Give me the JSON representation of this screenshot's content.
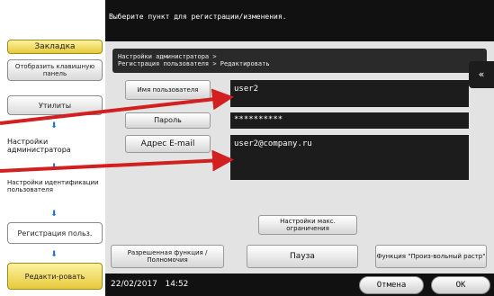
{
  "top_message": "Выберите пункт для регистрации/изменения.",
  "sidebar": {
    "bookmark_label": "Закладка",
    "keypad_label": "Отобразить клавишную панель",
    "utilities_label": "Утилиты",
    "admin_settings_label": "Настройки администратора",
    "user_auth_label": "Настройки идентификации пользователя",
    "user_registration_label": "Регистрация польз.",
    "edit_label": "Редакти-ровать"
  },
  "panel": {
    "header_line1": "Настройки администратора >",
    "header_line2": "Регистрация пользователя > Редактировать",
    "username_label": "Имя пользователя",
    "username_value": "user2",
    "password_label": "Пароль",
    "password_value": "**********",
    "email_label": "Адрес E-mail",
    "email_value": "user2@company.ru",
    "max_settings_label": "Настройки макс. ограничения",
    "collapse_icon": "«"
  },
  "bottom_buttons": {
    "permission_label": "Разрешенная функция /Полномочия",
    "pause_label": "Пауза",
    "custom_raster_label": "Функция \"Произ-вольный растр\""
  },
  "footer": {
    "date": "22/02/2017",
    "time": "14:52",
    "cancel_label": "Отмена",
    "ok_label": "OK"
  },
  "colors": {
    "annotation_red": "#d21f1f",
    "accent_yellow": "#f2d64b",
    "arrow_blue": "#1e6fd0"
  }
}
